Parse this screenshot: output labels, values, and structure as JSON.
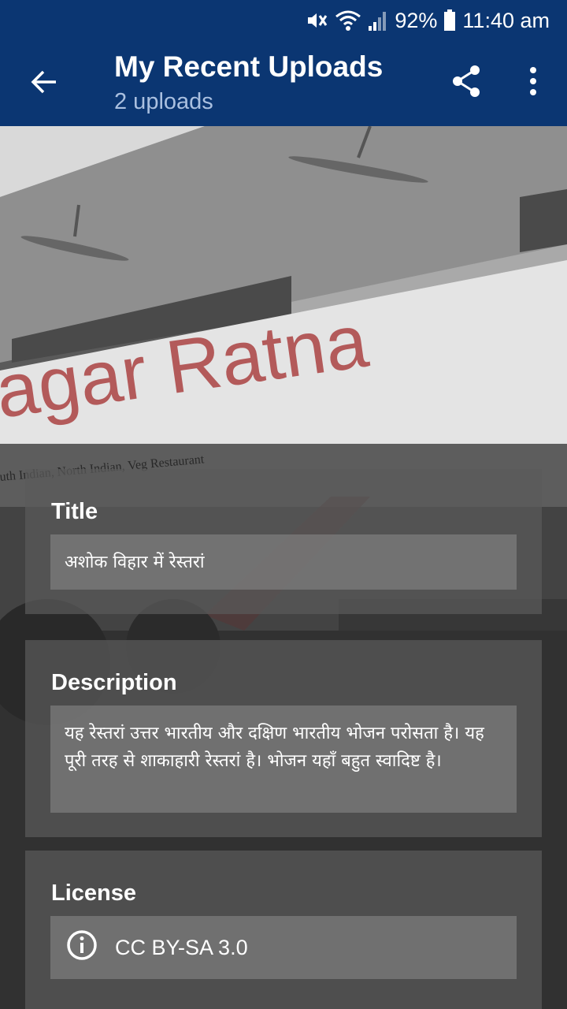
{
  "status_bar": {
    "battery": "92%",
    "time": "11:40 am",
    "icons": [
      "mute-icon",
      "wifi-icon",
      "signal-icon",
      "battery-icon"
    ]
  },
  "app_bar": {
    "title": "My Recent Uploads",
    "subtitle": "2 uploads",
    "icons": [
      "back-arrow-icon",
      "share-icon",
      "more-vert-icon"
    ],
    "color": "#0b3672"
  },
  "photo": {
    "sign_text": "agar Ratna",
    "sub_sign_text": "uth Indian, North Indian, Veg Restaurant"
  },
  "details": {
    "title_label": "Title",
    "title_value": "अशोक विहार में रेस्तरां",
    "description_label": "Description",
    "description_value": "यह रेस्तरां उत्तर भारतीय और दक्षिण भारतीय भोजन परोसता है। यह पूरी तरह से शाकाहारी रेस्तरां है। भोजन यहाँ बहुत स्वादिष्ट है।",
    "license_label": "License",
    "license_value": "CC BY-SA 3.0",
    "license_icon": "info-icon"
  }
}
